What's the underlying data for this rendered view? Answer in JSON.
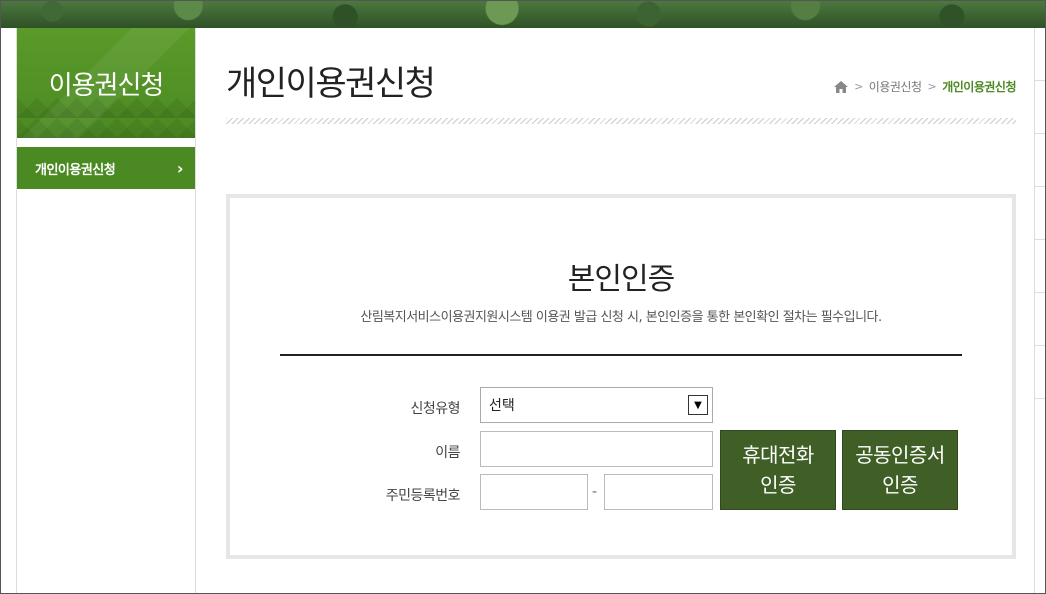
{
  "sidebar": {
    "title": "이용권신청",
    "items": [
      {
        "label": "개인이용권신청",
        "chevron": "›"
      }
    ]
  },
  "page": {
    "title": "개인이용권신청",
    "breadcrumb": {
      "home_icon": "home-icon",
      "items": [
        "이용권신청",
        "개인이용권신청"
      ],
      "separator": ">"
    }
  },
  "auth": {
    "title": "본인인증",
    "description": "산림복지서비스이용권지원시스템 이용권 발급 신청 시, 본인인증을 통한 본인확인 절차는 필수입니다.",
    "fields": {
      "type_label": "신청유형",
      "type_value": "선택",
      "name_label": "이름",
      "name_value": "",
      "rrn_label": "주민등록번호",
      "rrn_front": "",
      "rrn_back": "",
      "rrn_dash": "-"
    },
    "buttons": {
      "phone_line1": "휴대전화",
      "phone_line2": "인증",
      "cert_line1": "공동인증서",
      "cert_line2": "인증"
    }
  },
  "colors": {
    "brand_green": "#4b8a22",
    "button_green": "#3f5f26"
  }
}
